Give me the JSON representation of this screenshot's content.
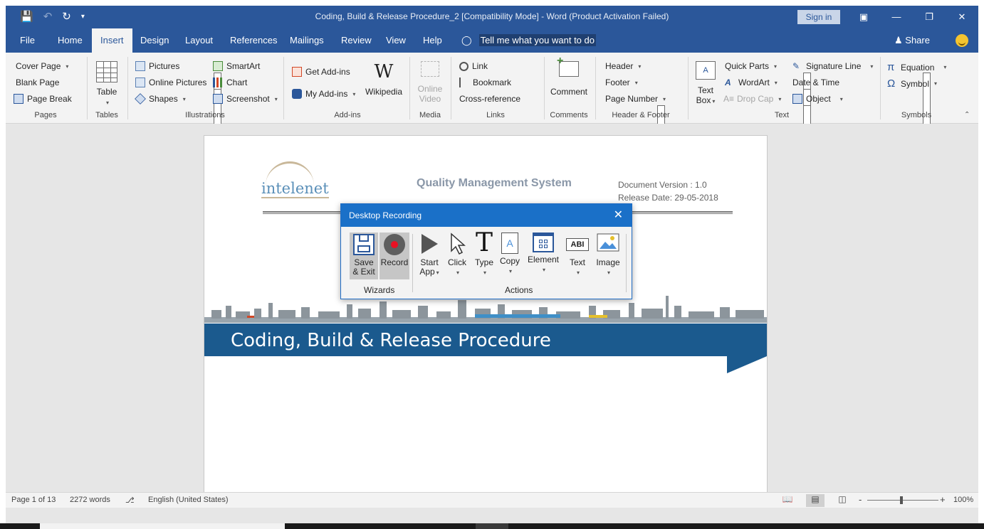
{
  "window": {
    "title": "Coding, Build & Release Procedure_2 [Compatibility Mode]  -  Word (Product Activation Failed)",
    "sign_in": "Sign in"
  },
  "tabs": [
    "File",
    "Home",
    "Insert",
    "Design",
    "Layout",
    "References",
    "Mailings",
    "Review",
    "View",
    "Help"
  ],
  "active_tab": "Insert",
  "tell_me": "Tell me what you want to do",
  "share": "Share",
  "ribbon": {
    "pages": {
      "label": "Pages",
      "cover_page": "Cover Page",
      "blank_page": "Blank Page",
      "page_break": "Page Break"
    },
    "tables": {
      "label": "Tables",
      "table": "Table"
    },
    "illustrations": {
      "label": "Illustrations",
      "pictures": "Pictures",
      "online_pictures": "Online Pictures",
      "shapes": "Shapes",
      "smartart": "SmartArt",
      "chart": "Chart",
      "screenshot": "Screenshot"
    },
    "addins": {
      "label": "Add-ins",
      "get_addins": "Get Add-ins",
      "my_addins": "My Add-ins",
      "wikipedia": "Wikipedia"
    },
    "media": {
      "label": "Media",
      "online": "Online",
      "video": "Video"
    },
    "links": {
      "label": "Links",
      "link": "Link",
      "bookmark": "Bookmark",
      "cross_reference": "Cross-reference"
    },
    "comments": {
      "label": "Comments",
      "comment": "Comment"
    },
    "header_footer": {
      "label": "Header & Footer",
      "header": "Header",
      "footer": "Footer",
      "page_number": "Page Number"
    },
    "text": {
      "label": "Text",
      "text_box_1": "Text",
      "text_box_2": "Box",
      "quick_parts": "Quick Parts",
      "wordart": "WordArt",
      "drop_cap": "Drop Cap",
      "signature_line": "Signature Line",
      "date_time": "Date & Time",
      "object": "Object"
    },
    "symbols": {
      "label": "Symbols",
      "equation": "Equation",
      "symbol": "Symbol"
    }
  },
  "document": {
    "logo_text": "intelenet",
    "qms_title": "Quality Management System",
    "doc_version": "Document Version : 1.0",
    "release_date": "Release Date: 29-05-2018",
    "banner_title": "Coding, Build & Release Procedure"
  },
  "dialog": {
    "title": "Desktop Recording",
    "wizards_label": "Wizards",
    "actions_label": "Actions",
    "save_exit_1": "Save",
    "save_exit_2": "& Exit",
    "record": "Record",
    "start_app_1": "Start",
    "start_app_2": "App",
    "click": "Click",
    "type": "Type",
    "copy": "Copy",
    "element": "Element",
    "text": "Text",
    "image": "Image"
  },
  "status": {
    "page": "Page 1 of 13",
    "words": "2272 words",
    "language": "English (United States)",
    "zoom": "100%"
  },
  "colors": {
    "accent": "#2b579a",
    "banner": "#1b5a8e",
    "dialog_title": "#1a70c8"
  }
}
